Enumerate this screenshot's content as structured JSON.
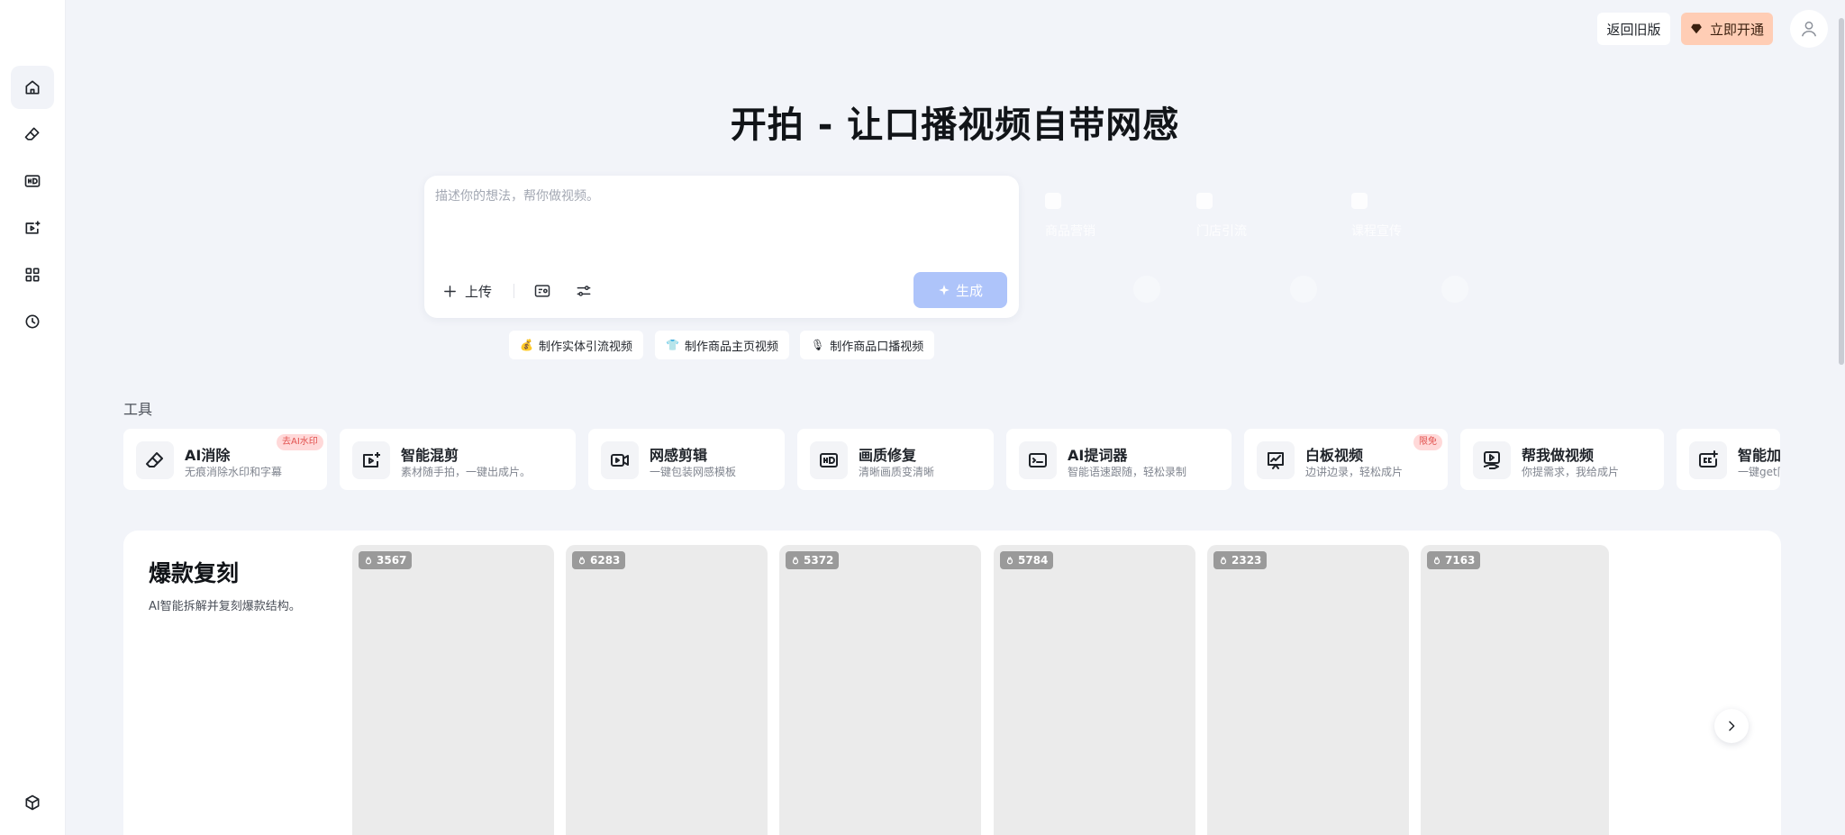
{
  "sidebar": {
    "items": [
      {
        "icon": "home-icon",
        "active": true
      },
      {
        "icon": "eraser-icon",
        "active": false
      },
      {
        "icon": "hd-icon",
        "active": false
      },
      {
        "icon": "video-plus-icon",
        "active": false
      },
      {
        "icon": "apps-grid-icon",
        "active": false
      },
      {
        "icon": "history-clock-icon",
        "active": false
      }
    ],
    "bottom_icon": "cube-icon"
  },
  "topbar": {
    "legacy_label": "返回旧版",
    "vip_label": "立即开通",
    "vip_color": "#ffcdb5"
  },
  "hero": {
    "title": "开拍 - 让口播视频自带网感"
  },
  "prompt": {
    "placeholder": "描述你的想法，帮你做视频。",
    "upload_label": "上传",
    "generate_label": "生成",
    "generate_color": "#aec4fa"
  },
  "ghost_features": [
    "商品营销",
    "门店引流",
    "课程宣传"
  ],
  "suggestions": [
    {
      "icon": "💰",
      "label": "制作实体引流视频"
    },
    {
      "icon": "👕",
      "label": "制作商品主页视频"
    },
    {
      "icon": "🎙",
      "label": "制作商品口播视频"
    }
  ],
  "tools": {
    "label": "工具",
    "items": [
      {
        "icon": "eraser-icon",
        "title": "AI消除",
        "subtitle": "无痕消除水印和字幕",
        "badge": "去AI水印"
      },
      {
        "icon": "video-mix-icon",
        "title": "智能混剪",
        "subtitle": "素材随手拍，一键出成片。",
        "badge": ""
      },
      {
        "icon": "video-edit-icon",
        "title": "网感剪辑",
        "subtitle": "一键包装网感模板",
        "badge": ""
      },
      {
        "icon": "hd-icon",
        "title": "画质修复",
        "subtitle": "清晰画质变清晰",
        "badge": ""
      },
      {
        "icon": "teleprompter-icon",
        "title": "AI提词器",
        "subtitle": "智能语速跟随，轻松录制",
        "badge": ""
      },
      {
        "icon": "whiteboard-icon",
        "title": "白板视频",
        "subtitle": "边讲边录，轻松成片",
        "badge": "限免"
      },
      {
        "icon": "help-video-icon",
        "title": "帮我做视频",
        "subtitle": "你提需求，我给成片",
        "badge": ""
      },
      {
        "icon": "caption-icon",
        "title": "智能加字幕",
        "subtitle": "一键get同款字幕",
        "badge": ""
      }
    ]
  },
  "replicate": {
    "title": "爆款复刻",
    "subtitle": "AI智能拆解并复刻爆款结构。",
    "videos": [
      {
        "views": "3567"
      },
      {
        "views": "6283"
      },
      {
        "views": "5372"
      },
      {
        "views": "5784"
      },
      {
        "views": "2323"
      },
      {
        "views": "7163"
      }
    ]
  }
}
